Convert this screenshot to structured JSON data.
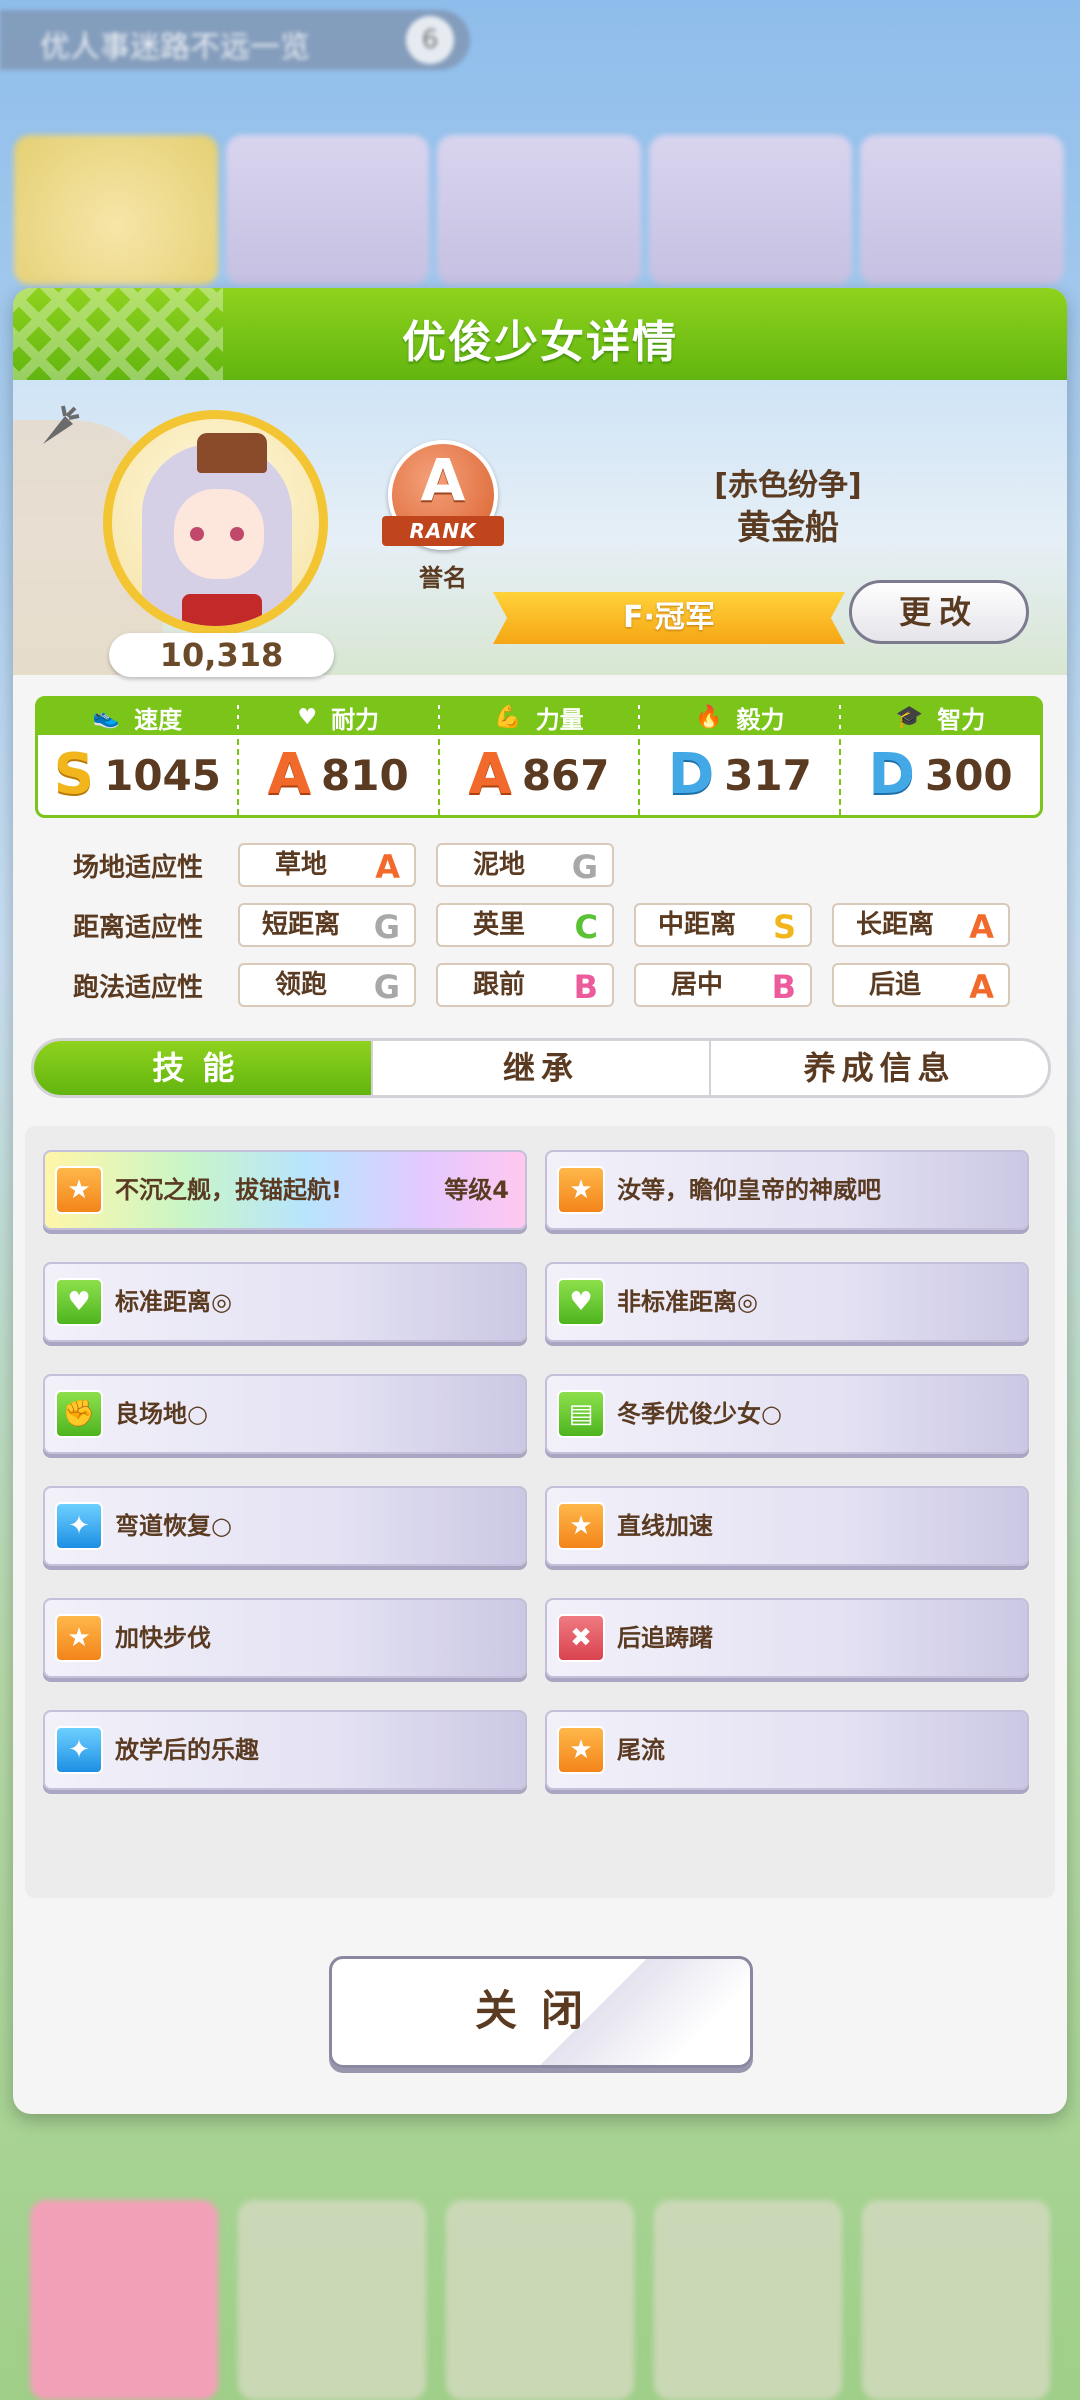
{
  "background": {
    "top_bar_text": "优人事迷路不远一览",
    "top_bar_badge": "6"
  },
  "modal": {
    "title": "优俊少女详情",
    "fans": "10,318",
    "rank_grade": "A",
    "rank_label": "RANK",
    "rank_caption": "誉名",
    "epithet": "[赤色纷争]",
    "character_name": "黄金船",
    "title_banner": "F·冠军",
    "change_button": "更改",
    "close_button": "关闭"
  },
  "stats": [
    {
      "label": "速度",
      "icon": "shoe-icon",
      "grade": "S",
      "value": "1045"
    },
    {
      "label": "耐力",
      "icon": "heart-icon",
      "grade": "A",
      "value": "810"
    },
    {
      "label": "力量",
      "icon": "muscle-icon",
      "grade": "A",
      "value": "867"
    },
    {
      "label": "毅力",
      "icon": "flame-icon",
      "grade": "D",
      "value": "317"
    },
    {
      "label": "智力",
      "icon": "graduation-cap-icon",
      "grade": "D",
      "value": "300"
    }
  ],
  "aptitude": {
    "track": {
      "label": "场地适应性",
      "items": [
        {
          "name": "草地",
          "grade": "A"
        },
        {
          "name": "泥地",
          "grade": "G"
        }
      ]
    },
    "distance": {
      "label": "距离适应性",
      "items": [
        {
          "name": "短距离",
          "grade": "G"
        },
        {
          "name": "英里",
          "grade": "C"
        },
        {
          "name": "中距离",
          "grade": "S"
        },
        {
          "name": "长距离",
          "grade": "A"
        }
      ]
    },
    "style": {
      "label": "跑法适应性",
      "items": [
        {
          "name": "领跑",
          "grade": "G"
        },
        {
          "name": "跟前",
          "grade": "B"
        },
        {
          "name": "居中",
          "grade": "B"
        },
        {
          "name": "后追",
          "grade": "A"
        }
      ]
    }
  },
  "tabs": [
    "技能",
    "继承",
    "养成信息"
  ],
  "skills": [
    {
      "name": "不沉之舰，拔锚起航!",
      "level": "等级4",
      "icon": "orange"
    },
    {
      "name": "汝等，瞻仰皇帝的神威吧",
      "level": "",
      "icon": "orange"
    },
    {
      "name": "标准距离◎",
      "level": "",
      "icon": "green"
    },
    {
      "name": "非标准距离◎",
      "level": "",
      "icon": "green"
    },
    {
      "name": "良场地○",
      "level": "",
      "icon": "green"
    },
    {
      "name": "冬季优俊少女○",
      "level": "",
      "icon": "green"
    },
    {
      "name": "弯道恢复○",
      "level": "",
      "icon": "blue"
    },
    {
      "name": "直线加速",
      "level": "",
      "icon": "orange"
    },
    {
      "name": "加快步伐",
      "level": "",
      "icon": "orange"
    },
    {
      "name": "后追踌躇",
      "level": "",
      "icon": "red"
    },
    {
      "name": "放学后的乐趣",
      "level": "",
      "icon": "blue"
    },
    {
      "name": "尾流",
      "level": "",
      "icon": "orange"
    }
  ]
}
